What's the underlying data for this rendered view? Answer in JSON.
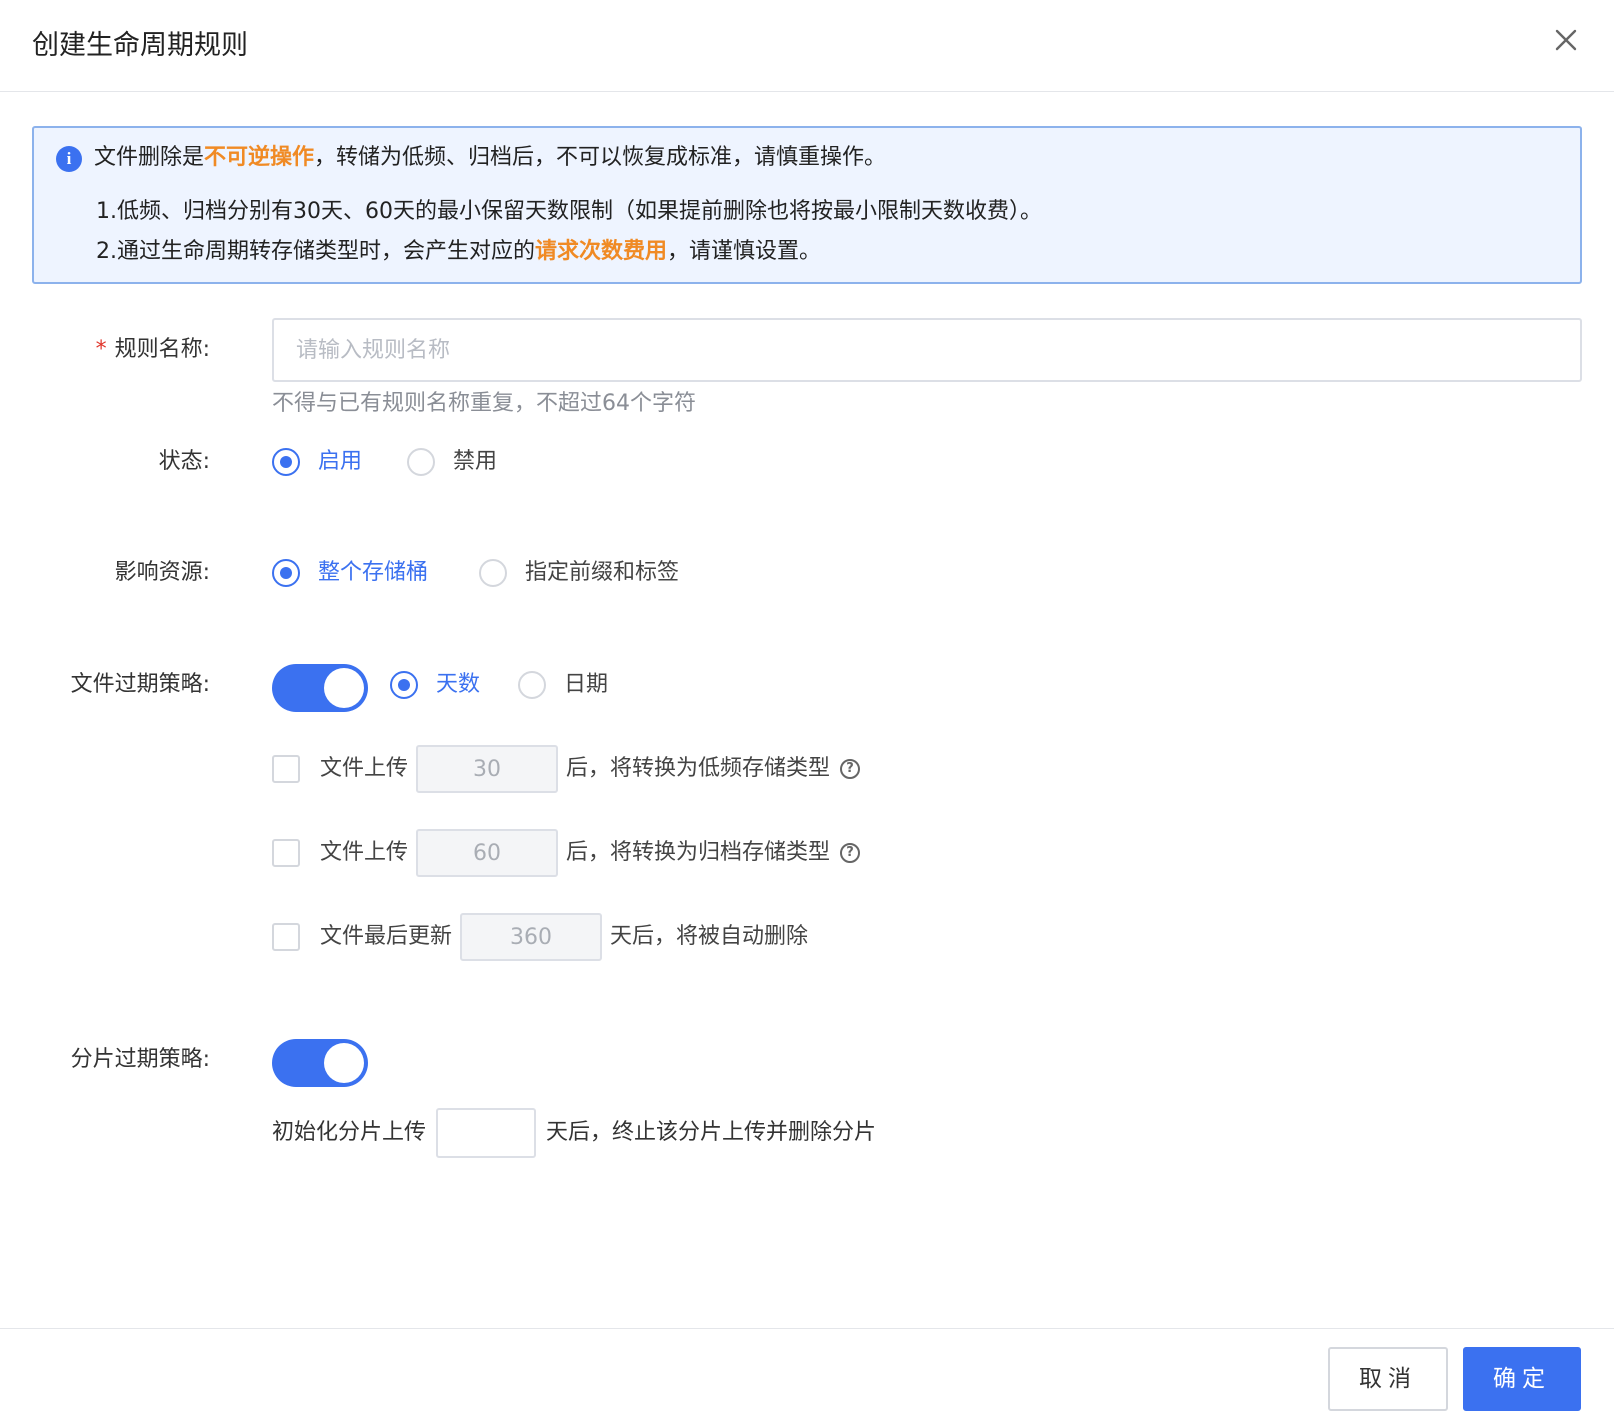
{
  "dialog": {
    "title": "创建生命周期规则",
    "close_icon": "close-icon"
  },
  "notice": {
    "icon": "info-icon",
    "icon_glyph": "i",
    "line1_a": "文件删除是",
    "line1_hl": "不可逆操作",
    "line1_b": "，转储为低频、归档后，不可以恢复成标准，请慎重操作。",
    "line2": "1.低频、归档分别有30天、60天的最小保留天数限制（如果提前删除也将按最小限制天数收费）。",
    "line3_a": "2.通过生命周期转存储类型时，会产生对应的",
    "line3_hl": "请求次数费用",
    "line3_b": "，请谨慎设置。",
    "highlight_color": "#f08a24"
  },
  "form": {
    "rule_name": {
      "required_mark": "*",
      "label": "规则名称:",
      "placeholder": "请输入规则名称",
      "value": "",
      "hint": "不得与已有规则名称重复，不超过64个字符"
    },
    "status": {
      "label": "状态:",
      "options": [
        "启用",
        "禁用"
      ],
      "selected": "启用"
    },
    "resource": {
      "label": "影响资源:",
      "options": [
        "整个存储桶",
        "指定前缀和标签"
      ],
      "selected": "整个存储桶"
    },
    "file_expire": {
      "label": "文件过期策略:",
      "enabled": true,
      "mode_options": [
        "天数",
        "日期"
      ],
      "mode_selected": "天数",
      "rules": [
        {
          "prefix": "文件上传",
          "value": "30",
          "suffix": "后，将转换为低频存储类型",
          "help_icon": "help-icon",
          "help_glyph": "?",
          "checked": false
        },
        {
          "prefix": "文件上传",
          "value": "60",
          "suffix": "后，将转换为归档存储类型",
          "help_icon": "help-icon",
          "help_glyph": "?",
          "checked": false
        },
        {
          "prefix": "文件最后更新",
          "value": "360",
          "suffix": "天后，将被自动删除",
          "checked": false
        }
      ]
    },
    "part_expire": {
      "label": "分片过期策略:",
      "enabled": true,
      "prefix": "初始化分片上传",
      "value": "",
      "suffix": "天后，终止该分片上传并删除分片"
    }
  },
  "footer": {
    "cancel_label": "取消",
    "ok_label": "确定"
  },
  "colors": {
    "primary": "#3b71f0",
    "required": "#e0352b"
  }
}
